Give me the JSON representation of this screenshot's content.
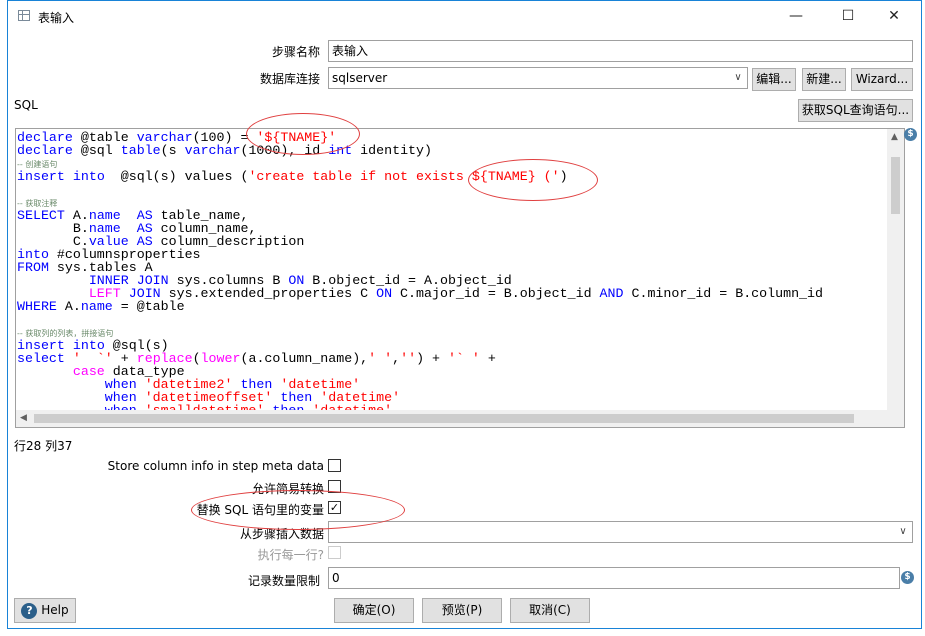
{
  "window": {
    "title": "表输入",
    "minimize": "—",
    "maximize": "☐",
    "close": "✕"
  },
  "form": {
    "step_name_label": "步骤名称",
    "step_name_value": "表输入",
    "db_label": "数据库连接",
    "db_value": "sqlserver",
    "edit_btn": "编辑...",
    "new_btn": "新建...",
    "wizard_btn": "Wizard...",
    "sql_label": "SQL",
    "get_sql_btn": "获取SQL查询语句...",
    "cursor_pos": "行28 列37",
    "store_col_info": "Store column info in step meta data",
    "lazy_conv": "允许简易转换",
    "replace_vars": "替换 SQL 语句里的变量",
    "insert_from_step": "从步骤插入数据",
    "exec_each_row": "执行每一行?",
    "limit_label": "记录数量限制",
    "limit_value": "0"
  },
  "checkboxes": {
    "store_col_info": false,
    "lazy_conv": false,
    "replace_vars": true,
    "exec_each_row": false
  },
  "buttons": {
    "help": "Help",
    "ok": "确定(O)",
    "preview": "预览(P)",
    "cancel": "取消(C)"
  },
  "code_lines": [
    [
      [
        "declare",
        "kw"
      ],
      [
        " @table ",
        "pl"
      ],
      [
        "varchar",
        "kw"
      ],
      [
        "(100) = ",
        "pl"
      ],
      [
        "'${TNAME}'",
        "str"
      ]
    ],
    [
      [
        "declare",
        "kw"
      ],
      [
        " @sql ",
        "pl"
      ],
      [
        "table",
        "kw"
      ],
      [
        "(s ",
        "pl"
      ],
      [
        "varchar",
        "kw"
      ],
      [
        "(1000), id ",
        "pl"
      ],
      [
        "int",
        "kw"
      ],
      [
        " identity)",
        "pl"
      ]
    ],
    [
      [
        "-- ",
        "cm"
      ],
      [
        "创建语句",
        "cm"
      ]
    ],
    [
      [
        "insert",
        "kw"
      ],
      [
        " ",
        "pl"
      ],
      [
        "into",
        "kw"
      ],
      [
        "  @sql(s) values (",
        "pl"
      ],
      [
        "'create table if not exists ${TNAME} ('",
        "str"
      ],
      [
        ")",
        "pl"
      ]
    ],
    [],
    [
      [
        "-- ",
        "cm"
      ],
      [
        "获取注释",
        "cm"
      ]
    ],
    [
      [
        "SELECT",
        "kw"
      ],
      [
        " A.",
        "pl"
      ],
      [
        "name",
        "kw"
      ],
      [
        "  ",
        "pl"
      ],
      [
        "AS",
        "kw"
      ],
      [
        " table_name,",
        "pl"
      ]
    ],
    [
      [
        "       B.",
        "pl"
      ],
      [
        "name",
        "kw"
      ],
      [
        "  ",
        "pl"
      ],
      [
        "AS",
        "kw"
      ],
      [
        " column_name,",
        "pl"
      ]
    ],
    [
      [
        "       C.",
        "pl"
      ],
      [
        "value",
        "kw"
      ],
      [
        " ",
        "pl"
      ],
      [
        "AS",
        "kw"
      ],
      [
        " column_description",
        "pl"
      ]
    ],
    [
      [
        "into",
        "kw"
      ],
      [
        " #columnsproperties",
        "pl"
      ]
    ],
    [
      [
        "FROM",
        "kw"
      ],
      [
        " sys.tables A",
        "pl"
      ]
    ],
    [
      [
        "         ",
        "pl"
      ],
      [
        "INNER",
        "kw"
      ],
      [
        " ",
        "pl"
      ],
      [
        "JOIN",
        "kw"
      ],
      [
        " sys.columns B ",
        "pl"
      ],
      [
        "ON",
        "kw"
      ],
      [
        " B.object_id = A.object_id",
        "pl"
      ]
    ],
    [
      [
        "         ",
        "pl"
      ],
      [
        "LEFT",
        "fn"
      ],
      [
        " ",
        "pl"
      ],
      [
        "JOIN",
        "kw"
      ],
      [
        " sys.extended_properties C ",
        "pl"
      ],
      [
        "ON",
        "kw"
      ],
      [
        " C.major_id = B.object_id ",
        "pl"
      ],
      [
        "AND",
        "kw"
      ],
      [
        " C.minor_id = B.column_id",
        "pl"
      ]
    ],
    [
      [
        "WHERE",
        "kw"
      ],
      [
        " A.",
        "pl"
      ],
      [
        "name",
        "kw"
      ],
      [
        " = @table",
        "pl"
      ]
    ],
    [],
    [
      [
        "-- ",
        "cm"
      ],
      [
        "获取列的列表，拼接语句",
        "cm"
      ]
    ],
    [
      [
        "insert",
        "kw"
      ],
      [
        " ",
        "pl"
      ],
      [
        "into",
        "kw"
      ],
      [
        " @sql(s)",
        "pl"
      ]
    ],
    [
      [
        "select",
        "kw"
      ],
      [
        " ",
        "pl"
      ],
      [
        "'  `'",
        "str"
      ],
      [
        " + ",
        "pl"
      ],
      [
        "replace",
        "fn"
      ],
      [
        "(",
        "pl"
      ],
      [
        "lower",
        "fn"
      ],
      [
        "(a.column_name),",
        "pl"
      ],
      [
        "' '",
        "str"
      ],
      [
        ",",
        "pl"
      ],
      [
        "''",
        "str"
      ],
      [
        ") + ",
        "pl"
      ],
      [
        "'` '",
        "str"
      ],
      [
        " +",
        "pl"
      ]
    ],
    [
      [
        "       ",
        "pl"
      ],
      [
        "case",
        "fn"
      ],
      [
        " data_type",
        "pl"
      ]
    ],
    [
      [
        "           ",
        "pl"
      ],
      [
        "when",
        "kw"
      ],
      [
        " ",
        "pl"
      ],
      [
        "'datetime2'",
        "str"
      ],
      [
        " ",
        "pl"
      ],
      [
        "then",
        "kw"
      ],
      [
        " ",
        "pl"
      ],
      [
        "'datetime'",
        "str"
      ]
    ],
    [
      [
        "           ",
        "pl"
      ],
      [
        "when",
        "kw"
      ],
      [
        " ",
        "pl"
      ],
      [
        "'datetimeoffset'",
        "str"
      ],
      [
        " ",
        "pl"
      ],
      [
        "then",
        "kw"
      ],
      [
        " ",
        "pl"
      ],
      [
        "'datetime'",
        "str"
      ]
    ],
    [
      [
        "           ",
        "pl"
      ],
      [
        "when",
        "kw"
      ],
      [
        " ",
        "pl"
      ],
      [
        "'smalldatetime'",
        "str"
      ],
      [
        " ",
        "pl"
      ],
      [
        "then",
        "kw"
      ],
      [
        " ",
        "pl"
      ],
      [
        "'datetime'",
        "str"
      ]
    ]
  ],
  "colors": {
    "accent": "#1883d7",
    "annotation": "#e04040",
    "keyword": "#0000ff",
    "string": "#ff0000",
    "function": "#ff00ff"
  },
  "icons": {
    "title": "table-input-icon",
    "help": "question-circle-icon",
    "variable": "dollar-variable-icon"
  }
}
